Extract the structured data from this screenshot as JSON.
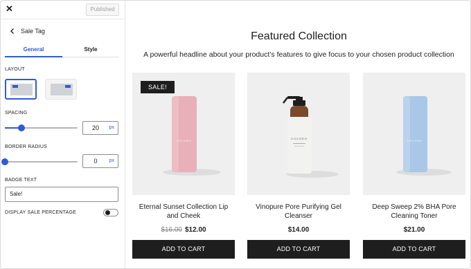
{
  "sidebar": {
    "close_label": "✕",
    "published_label": "Published",
    "back_title": "Sale Tag",
    "tabs": [
      {
        "label": "General",
        "active": true
      },
      {
        "label": "Style",
        "active": false
      }
    ],
    "layout_label": "LAYOUT",
    "spacing_label": "SPACING",
    "spacing_value": "20",
    "spacing_unit": "px",
    "spacing_slider_level": 0.23,
    "border_radius_label": "BORDER RADIUS",
    "border_radius_value": "0",
    "border_radius_unit": "px",
    "border_radius_slider_level": 0.0,
    "badge_text_label": "BADGE TEXT",
    "badge_text_value": "Sale!",
    "display_sale_label": "DISPLAY SALE PERCENTAGE",
    "display_sale_on": false,
    "accent_color": "#2f5bd3"
  },
  "canvas": {
    "heading": "Featured Collection",
    "subheading": "A powerful headline about your product’s features to give focus to your chosen product collection",
    "badge": "SALE!",
    "products": [
      {
        "title_line1": "Eternal Sunset Collection Lip",
        "title_line2": "and Cheek",
        "old_price": "$16.00",
        "price": "$12.00",
        "button": "ADD TO CART",
        "bottle_color": "#e8b0b8",
        "brand_mark": "COCOEO"
      },
      {
        "title_line1": "Vinopure Pore Purifying Gel",
        "title_line2": "Cleanser",
        "old_price": "",
        "price": "$14.00",
        "button": "ADD TO CART",
        "bottle_color": "#f2f2f0",
        "brand_mark": "COCOEO"
      },
      {
        "title_line1": "Deep Sweep 2% BHA Pore",
        "title_line2": "Cleaning Toner",
        "old_price": "",
        "price": "$21.00",
        "button": "ADD TO CART",
        "bottle_color": "#a9c7e6",
        "brand_mark": "COCOEO"
      }
    ]
  }
}
